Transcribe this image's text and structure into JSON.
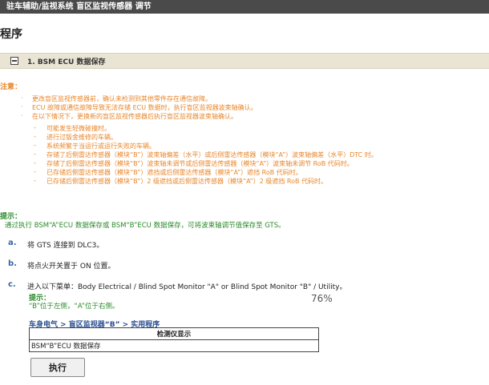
{
  "topbar": {
    "breadcrumb": "驻车辅助/监视系统  盲区监视传感器  调节"
  },
  "page": {
    "heading": "程序"
  },
  "section": {
    "title": "1. BSM ECU 数据保存"
  },
  "caution": {
    "label": "注意：",
    "items": [
      "更改盲区监视传感器前，确认未检测到其他零件存在通信故障。",
      "ECU 故障或通信故障导致无法存储 ECU 数据时，执行盲区监视器波束轴确认。",
      "在以下情况下，更换新的盲区监视传感器后执行盲区监视器波束轴确认。"
    ],
    "subitems": [
      "可能发生轻微碰撞时。",
      "进行过钣金维修的车辆。",
      "系统频繁于当运行或运行失败的车辆。",
      "存储了后侧雷达传感器（模块“B”）波束轴偏差（水平）或后侧雷达传感器（模块“A”）波束轴偏差（水平）DTC 时。",
      "存储了后侧雷达传感器（模块“B”）波束轴未调节或后侧雷达传感器（模块“A”）波束轴未调节 RoB 代码时。",
      "已存储后侧雷达传感器（模块“B”）遮挡或后侧雷达传感器（模块“A”）遮挡 RoB 代码时。",
      "已存储后侧雷达传感器（模块“B”）2 级遮挡或后侧雷达传感器（模块“A”）2 级遮挡 RoB 代码时。"
    ]
  },
  "hint": {
    "label": "提示：",
    "text": "通过执行 BSM“A”ECU 数据保存或 BSM“B”ECU 数据保存，可将波束轴调节值保存至 GTS。"
  },
  "steps": [
    {
      "letter": "a.",
      "text": "将 GTS 连接到 DLC3。"
    },
    {
      "letter": "b.",
      "text": "将点火开关置于 ON 位置。"
    },
    {
      "letter": "c.",
      "text": "进入以下菜单：Body Electrical / Blind Spot Monitor \"A\" or Blind Spot Monitor \"B\" / Utility。"
    }
  ],
  "sub_hint": {
    "label": "提示：",
    "text": "“B”位于左侧，“A”位于右侧。"
  },
  "zoom": {
    "label": "76%"
  },
  "menu_path": "车身电气 > 盲区监视器“B” > 实用程序",
  "table": {
    "header": "检测仪显示",
    "row": "BSM“B”ECU 数据保存"
  },
  "execute_button": {
    "label": "执行"
  }
}
